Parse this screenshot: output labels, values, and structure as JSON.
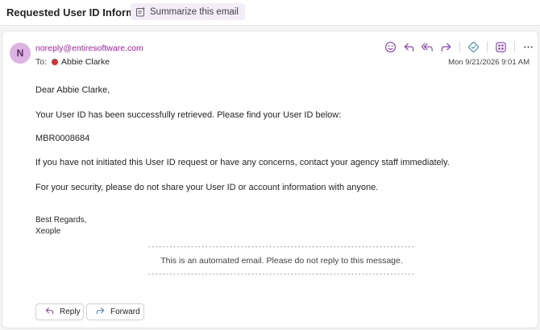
{
  "header": {
    "subject": "Requested User ID Information",
    "summarize_label": "Summarize this email"
  },
  "message": {
    "avatar_initial": "N",
    "sender": "noreply@entiresoftware.com",
    "to_label": "To:",
    "recipient": "Abbie Clarke",
    "date": "Mon 9/21/2026 9:01 AM",
    "greeting": "Dear Abbie Clarke,",
    "line1": "Your User ID has been successfully retrieved. Please find your User ID below:",
    "user_id": "MBR0008684",
    "line2": "If you have not initiated this User ID request or have any concerns, contact your agency staff immediately.",
    "line3": "For your security, please do not share your User ID or account information with anyone.",
    "signoff": "Best Regards,",
    "signature": "Xeople",
    "notice": "This is an automated email. Please do not reply to this message.",
    "notice_rule": "--------------------------------------------------------------------------------"
  },
  "toolbar": {
    "icons": [
      "emoji-icon",
      "reply-icon",
      "reply-all-icon",
      "forward-icon",
      "sync-icon",
      "apps-icon",
      "more-icon"
    ]
  },
  "footer": {
    "reply_label": "Reply",
    "forward_label": "Forward"
  },
  "colors": {
    "accent": "#b11fb1",
    "avatar_bg": "#dcb3e3",
    "icon_purple": "#8a3bc4",
    "status_dot": "#d13438"
  }
}
